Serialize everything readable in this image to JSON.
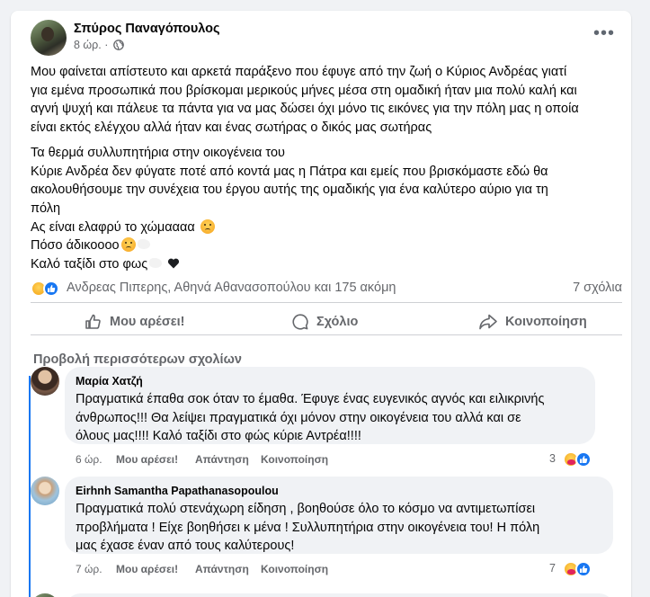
{
  "post": {
    "author": "Σπύρος Παναγόπουλος",
    "time": "8 ώρ.",
    "separator": "·",
    "paragraph1": [
      "Μου φαίνεται απίστευτο και αρκετά παράξενο που έφυγε από την ζωή ο Κύριος Ανδρέας γιατί",
      "για εμένα προσωπικά που βρίσκομαι μερικούς μήνες μέσα στη ομαδική ήταν μια πολύ καλή και",
      "αγνή ψυχή και πάλευε τα πάντα για να μας δώσει όχι μόνο τις εικόνες για την πόλη μας η οποία",
      "είναι εκτός ελέγχου αλλά ήταν και ένας σωτήρας ο δικός μας σωτήρας"
    ],
    "paragraph2": [
      "Τα θερμά συλλυπητήρια στην οικογένεια του",
      "Κύριε Ανδρέα δεν φύγατε ποτέ από κοντά μας η Πάτρα και εμείς που βρισκόμαστε εδώ θα",
      "ακολουθήσουμε την συνέχεια του έργου αυτής της ομαδικής για ένα καλύτερο αύριο για τη",
      "πόλη"
    ],
    "line_soil": "Ας είναι ελαφρύ το χώμαααα",
    "line_unfair": "Πόσο άδικοοοο",
    "line_journey": "Καλό ταξίδι στο φως",
    "reactions_names": "Ανδρεας Πιπερης, Αθηνά Αθανασοπούλου και 175 ακόμη",
    "comments_count": "7 σχόλια"
  },
  "actions": {
    "like": "Μου αρέσει!",
    "comment": "Σχόλιο",
    "share": "Κοινοποίηση"
  },
  "view_more_comments": "Προβολή περισσότερων σχολίων",
  "comments": [
    {
      "name": "Μαρία Χατζή",
      "text": [
        "Πραγματικά έπαθα σοκ όταν το έμαθα. Έφυγε ένας ευγενικός αγνός και ειλικρινής",
        "άνθρωπος!!! Θα λείψει πραγματικά όχι μόνον στην οικογένεια του αλλά και σε",
        "όλους μας!!!! Καλό ταξίδι στο φώς κύριε Αντρέα!!!!"
      ],
      "time": "6 ώρ.",
      "like": "Μου αρέσει!",
      "reply": "Απάντηση",
      "share": "Κοινοποίηση",
      "reaction_count": "3"
    },
    {
      "name": "Eirhnh Samantha Papathanasopoulou",
      "text": [
        "Πραγματικά πολύ στενάχωρη είδηση , βοηθούσε όλο το κόσμο να αντιμετωπίσει",
        "προβλήματα ! Είχε βοηθήσει κ μένα ! Συλλυπητήρια στην οικογένεια του! Η πόλη",
        "μας έχασε έναν από τους καλύτερους!"
      ],
      "time": "7 ώρ.",
      "like": "Μου αρέσει!",
      "reply": "Απάντηση",
      "share": "Κοινοποίηση",
      "reaction_count": "7"
    }
  ],
  "colors": {
    "accent": "#1877f2",
    "secondary_text": "#65676b",
    "bubble": "#f0f2f5"
  },
  "icons": [
    "globe-icon",
    "more-options-icon",
    "like-icon",
    "comment-icon",
    "share-icon",
    "sad-reaction-icon",
    "care-reaction-icon",
    "dove-emoji",
    "black-heart-emoji"
  ]
}
